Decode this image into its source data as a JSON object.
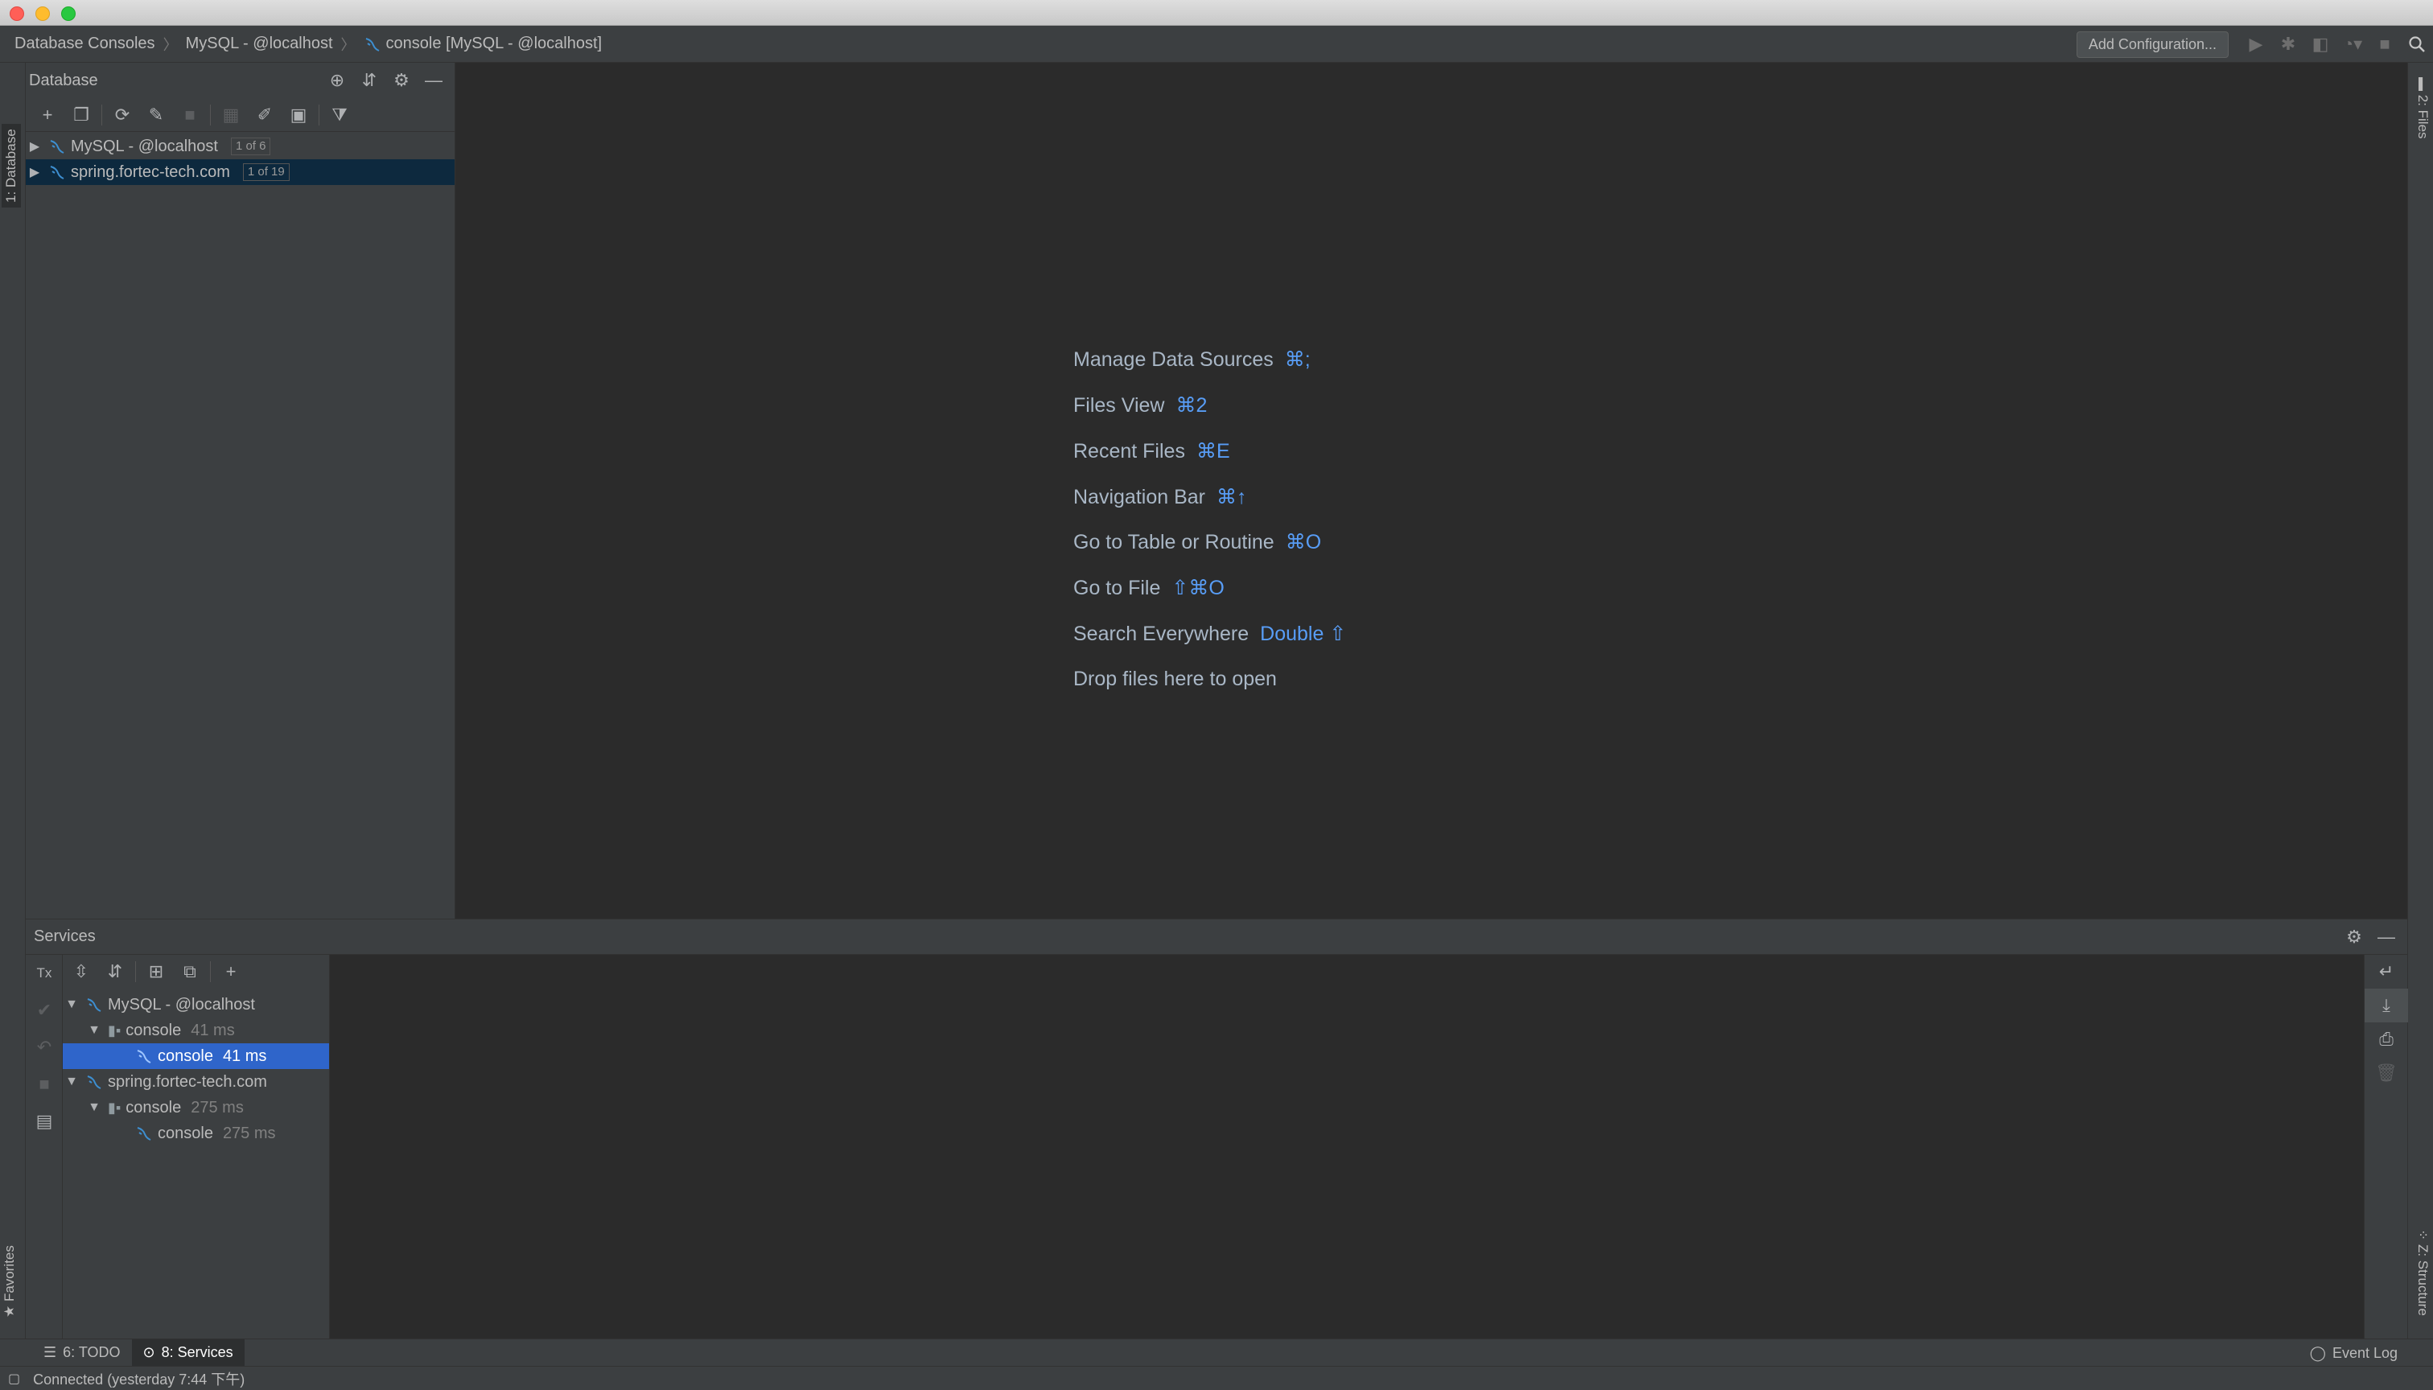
{
  "navbar": {
    "breadcrumbs": [
      "Database Consoles",
      "MySQL - @localhost",
      "console [MySQL - @localhost]"
    ],
    "add_configuration": "Add Configuration..."
  },
  "side_tabs": {
    "left_top": "1: Database",
    "left_bottom": "Favorites",
    "right_top": "2: Files",
    "right_bottom": "Z: Structure"
  },
  "database_panel": {
    "title": "Database",
    "tree": [
      {
        "label": "MySQL - @localhost",
        "badge": "1 of 6",
        "selected": false
      },
      {
        "label": "spring.fortec-tech.com",
        "badge": "1 of 19",
        "selected": true
      }
    ]
  },
  "editor": {
    "hints": [
      {
        "label": "Manage Data Sources",
        "shortcut": "⌘;"
      },
      {
        "label": "Files View",
        "shortcut": "⌘2"
      },
      {
        "label": "Recent Files",
        "shortcut": "⌘E"
      },
      {
        "label": "Navigation Bar",
        "shortcut": "⌘↑"
      },
      {
        "label": "Go to Table or Routine",
        "shortcut": "⌘O"
      },
      {
        "label": "Go to File",
        "shortcut": "⇧⌘O"
      },
      {
        "label": "Search Everywhere",
        "shortcut": "Double ⇧"
      },
      {
        "label": "Drop files here to open",
        "shortcut": ""
      }
    ]
  },
  "services": {
    "title": "Services",
    "tx_label": "Tx",
    "tree": [
      {
        "label": "MySQL - @localhost",
        "time": ""
      },
      {
        "label": "console",
        "time": "41 ms"
      },
      {
        "label": "console",
        "time": "41 ms"
      },
      {
        "label": "spring.fortec-tech.com",
        "time": ""
      },
      {
        "label": "console",
        "time": "275 ms"
      },
      {
        "label": "console",
        "time": "275 ms"
      }
    ]
  },
  "bottom_tabs": {
    "todo": "6: TODO",
    "services": "8: Services",
    "event_log": "Event Log"
  },
  "status": {
    "text": "Connected (yesterday 7:44 下午)"
  },
  "colors": {
    "accent": "#589df6",
    "selection": "#2f65ca",
    "background": "#2b2b2b",
    "panel": "#3c3f41"
  }
}
